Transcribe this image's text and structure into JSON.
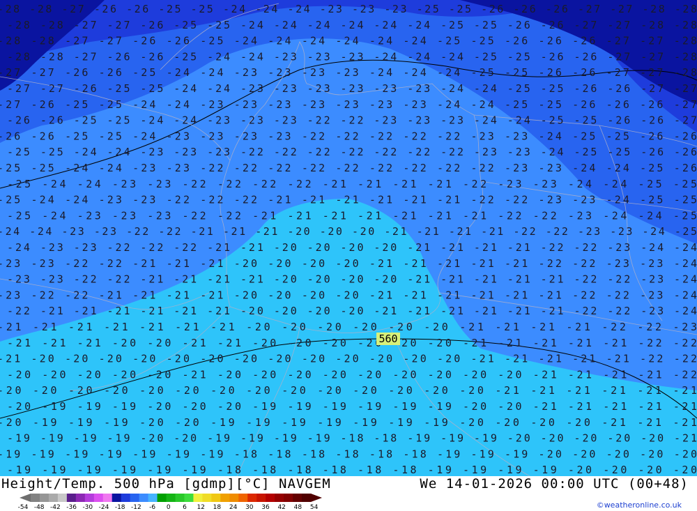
{
  "footer": {
    "title": "Height/Temp. 500 hPa [gdmp][°C] NAVGEM",
    "datetime": "We 14-01-2026 00:00 UTC (00+48)",
    "credit": "©weatheronline.co.uk"
  },
  "colorbar": {
    "ticks": [
      "-54",
      "-48",
      "-42",
      "-36",
      "-30",
      "-24",
      "-18",
      "-12",
      "-6",
      "0",
      "6",
      "12",
      "18",
      "24",
      "30",
      "36",
      "42",
      "48",
      "54"
    ],
    "colors": [
      "#828282",
      "#969696",
      "#aaaaaa",
      "#c8c8c8",
      "#5a1e8c",
      "#8c28b4",
      "#b43cdc",
      "#dc50f0",
      "#f078f0",
      "#0a14a0",
      "#1e3cdc",
      "#2864f0",
      "#3c8cff",
      "#46b4ff",
      "#00a000",
      "#14b414",
      "#28c828",
      "#3cdc3c",
      "#f0f03c",
      "#f0dc28",
      "#f0c814",
      "#f0a000",
      "#f08c00",
      "#f06400",
      "#dc2800",
      "#c81400",
      "#b40000",
      "#960000",
      "#820000",
      "#640000",
      "#500000"
    ]
  },
  "map": {
    "label_560": "560",
    "band_colors": [
      "#0a14a0",
      "#1e3cdc",
      "#2864f0",
      "#3c8cff",
      "#2ec4fa"
    ],
    "labels": [
      {
        "row": 0,
        "text": "-28 -28 -27 -26 -26 -25 -25 -24 -24 -24 -23 -23 -23 -25 -25 -26 -26 -26 -27 -27 -28 -28"
      },
      {
        "row": 1,
        "text": "-28 -28 -27 -27 -26 -25 -25 -24 -24 -24 -24 -24 -24 -25 -25 -26 -26 -27 -27 -28 -28"
      },
      {
        "row": 2,
        "text": "-28 -28 -27 -27 -26 -26 -25 -24 -24 -24 -24 -24 -24 -25 -25 -26 -26 -26 -27 -27 -28"
      },
      {
        "row": 3,
        "text": "-28 -28 -27 -26 -26 -25 -24 -24 -23 -23 -23 -24 -24 -24 -25 -25 -26 -26 -27 -27 -28"
      },
      {
        "row": 4,
        "text": "-27 -27 -26 -26 -25 -24 -24 -23 -23 -23 -23 -24 -24 -24 -25 -25 -26 -26 -27 -27 -28"
      },
      {
        "row": 5,
        "text": "-27 -27 -26 -25 -25 -24 -24 -23 -23 -23 -23 -23 -23 -24 -24 -25 -25 -26 -26 -27 -27"
      },
      {
        "row": 6,
        "text": "-27 -26 -25 -25 -24 -24 -23 -23 -23 -23 -23 -23 -23 -24 -24 -25 -25 -26 -26 -26 -27"
      },
      {
        "row": 7,
        "text": "-26 -26 -25 -25 -24 -24 -23 -23 -23 -22 -22 -23 -23 -23 -24 -24 -25 -25 -26 -26 -27"
      },
      {
        "row": 8,
        "text": "-26 -26 -25 -25 -24 -23 -23 -23 -23 -22 -22 -22 -22 -22 -23 -23 -24 -25 -25 -26 -26"
      },
      {
        "row": 9,
        "text": "-25 -25 -24 -24 -23 -23 -23 -22 -22 -22 -22 -22 -22 -22 -23 -23 -24 -25 -25 -26 -26"
      },
      {
        "row": 10,
        "text": "-25 -25 -24 -24 -23 -23 -22 -22 -22 -22 -22 -22 -22 -22 -22 -23 -23 -24 -24 -25 -26"
      },
      {
        "row": 11,
        "text": "-25 -24 -24 -23 -23 -22 -22 -22 -22 -21 -21 -21 -21 -22 -23 -23 -24 -24 -25 -25"
      },
      {
        "row": 12,
        "text": "-25 -24 -24 -23 -23 -22 -22 -22 -21 -21 -21 -21 -21 -21 -22 -22 -23 -23 -24 -25 -25"
      },
      {
        "row": 13,
        "text": "-25 -24 -23 -23 -23 -22 -22 -21 -21 -21 -21 -21 -21 -21 -22 -22 -23 -24 -24 -25"
      },
      {
        "row": 14,
        "text": "-24 -24 -23 -23 -22 -22 -21 -21 -21 -20 -20 -20 -21 -21 -21 -21 -22 -22 -23 -23 -24 -25"
      },
      {
        "row": 15,
        "text": "-24 -23 -23 -22 -22 -22 -21 -21 -20 -20 -20 -20 -21 -21 -21 -21 -22 -22 -23 -24 -24"
      },
      {
        "row": 16,
        "text": "-23 -23 -22 -22 -21 -21 -21 -20 -20 -20 -20 -21 -21 -21 -21 -21 -22 -22 -23 -23 -24"
      },
      {
        "row": 17,
        "text": "-23 -23 -22 -22 -21 -21 -21 -21 -20 -20 -20 -20 -21 -21 -21 -21 -21 -22 -22 -23 -24"
      },
      {
        "row": 18,
        "text": "-23 -22 -22 -21 -21 -21 -21 -20 -20 -20 -20 -21 -21 -21 -21 -21 -21 -22 -22 -23 -24"
      },
      {
        "row": 19,
        "text": "-22 -21 -21 -21 -21 -21 -21 -20 -20 -20 -20 -21 -21 -21 -21 -21 -21 -22 -22 -23 -24"
      },
      {
        "row": 20,
        "text": "-21 -21 -21 -21 -21 -21 -21 -20 -20 -20 -20 -20 -20 -21 -21 -21 -21 -22 -22 -23"
      },
      {
        "row": 21,
        "text": "-21 -21 -21 -20 -20 -21 -21 -20 -20 -20 -20 -20 -20 -21 -21 -21 -21 -21 -22 -22"
      },
      {
        "row": 22,
        "text": "-21 -20 -20 -20 -20 -20 -20 -20 -20 -20 -20 -20 -20 -20 -21 -21 -21 -21 -21 -22 -22"
      },
      {
        "row": 23,
        "text": "-20 -20 -20 -20 -20 -21 -20 -20 -20 -20 -20 -20 -20 -20 -20 -21 -21 -21 -21 -22"
      },
      {
        "row": 24,
        "text": "-20 -20 -20 -20 -20 -20 -20 -20 -20 -20 -20 -20 -20 -20 -21 -21 -21 -21 -21 -21"
      },
      {
        "row": 25,
        "text": "-20 -19 -19 -19 -20 -20 -20 -19 -19 -19 -19 -19 -19 -20 -20 -21 -21 -21 -21 -21"
      },
      {
        "row": 26,
        "text": "-20 -19 -19 -19 -20 -20 -19 -19 -19 -19 -19 -19 -19 -20 -20 -20 -20 -21 -21 -21"
      },
      {
        "row": 27,
        "text": "-19 -19 -19 -19 -20 -20 -19 -19 -19 -19 -18 -18 -19 -19 -19 -20 -20 -20 -20 -20 -21"
      },
      {
        "row": 28,
        "text": "-19 -19 -19 -19 -19 -19 -19 -18 -18 -18 -18 -18 -18 -19 -19 -19 -20 -20 -20 -20 -20"
      },
      {
        "row": 29,
        "text": "-19 -19 -19 -19 -19 -19 -18 -18 -18 -18 -18 -18 -19 -19 -19 -19 -20 -20 -20 -20"
      }
    ]
  }
}
